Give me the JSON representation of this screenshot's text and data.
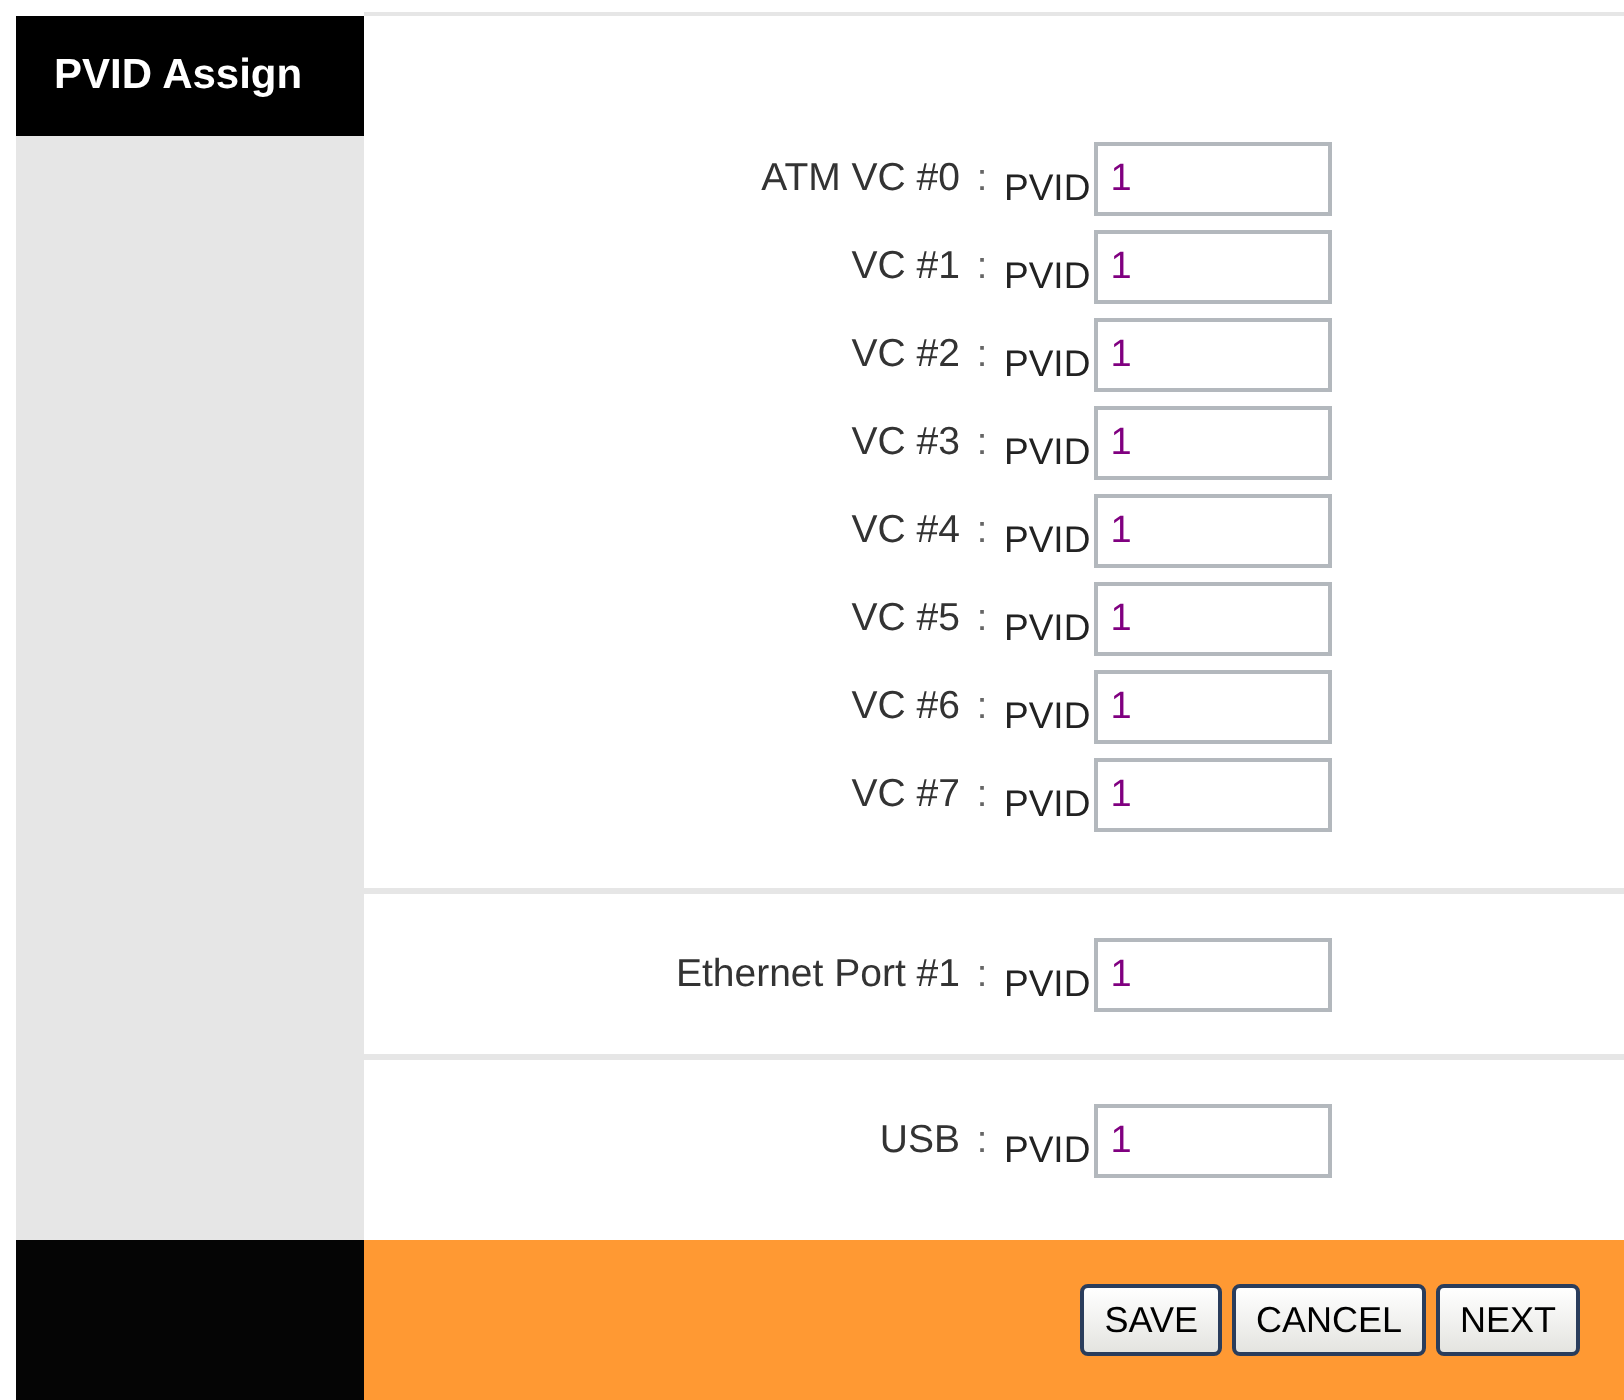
{
  "sidebar": {
    "title": "PVID Assign"
  },
  "groups": [
    {
      "rows": [
        {
          "label": "ATM VC #0",
          "separator": ":",
          "unit": "PVID",
          "value": "1"
        },
        {
          "label": "VC #1",
          "separator": ":",
          "unit": "PVID",
          "value": "1"
        },
        {
          "label": "VC #2",
          "separator": ":",
          "unit": "PVID",
          "value": "1"
        },
        {
          "label": "VC #3",
          "separator": ":",
          "unit": "PVID",
          "value": "1"
        },
        {
          "label": "VC #4",
          "separator": ":",
          "unit": "PVID",
          "value": "1"
        },
        {
          "label": "VC #5",
          "separator": ":",
          "unit": "PVID",
          "value": "1"
        },
        {
          "label": "VC #6",
          "separator": ":",
          "unit": "PVID",
          "value": "1"
        },
        {
          "label": "VC #7",
          "separator": ":",
          "unit": "PVID",
          "value": "1"
        }
      ]
    },
    {
      "rows": [
        {
          "label": "Ethernet Port #1",
          "separator": ":",
          "unit": "PVID",
          "value": "1"
        }
      ]
    },
    {
      "rows": [
        {
          "label": "USB",
          "separator": ":",
          "unit": "PVID",
          "value": "1"
        }
      ]
    }
  ],
  "buttons": [
    "SAVE",
    "CANCEL",
    "NEXT"
  ]
}
